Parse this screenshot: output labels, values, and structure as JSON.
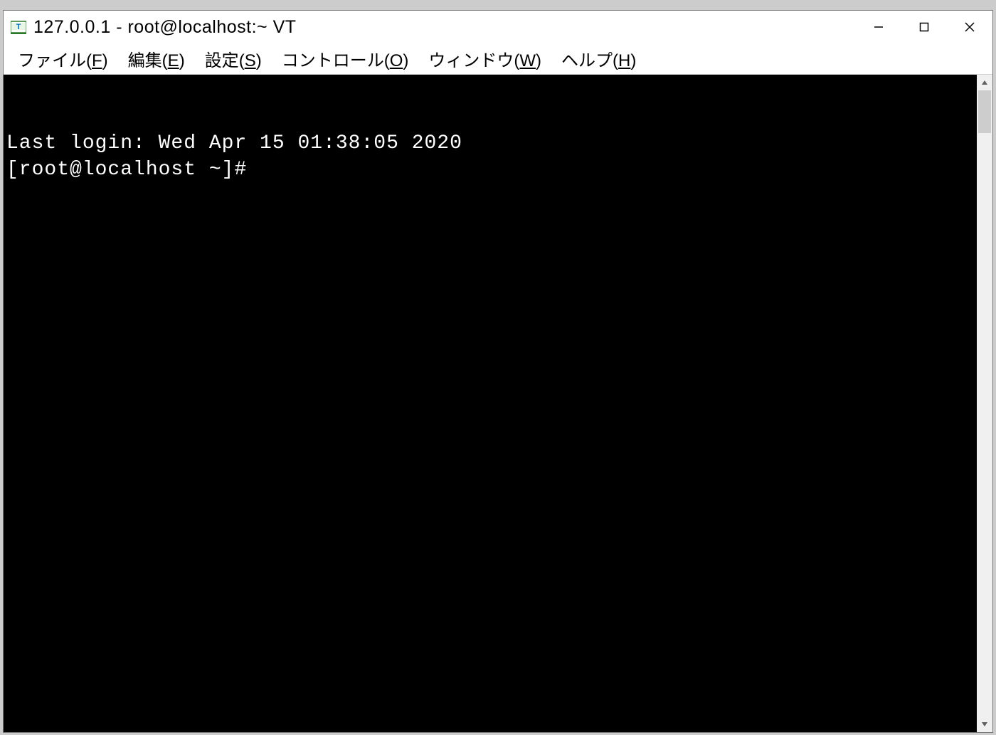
{
  "window": {
    "title": "127.0.0.1 - root@localhost:~ VT"
  },
  "menubar": {
    "file": {
      "label": "ファイル",
      "mnemonic": "F"
    },
    "edit": {
      "label": "編集",
      "mnemonic": "E"
    },
    "setup": {
      "label": "設定",
      "mnemonic": "S"
    },
    "control": {
      "label": "コントロール",
      "mnemonic": "O"
    },
    "window": {
      "label": "ウィンドウ",
      "mnemonic": "W"
    },
    "help": {
      "label": "ヘルプ",
      "mnemonic": "H"
    }
  },
  "terminal": {
    "lines": [
      "Last login: Wed Apr 15 01:38:05 2020",
      "[root@localhost ~]# "
    ]
  }
}
